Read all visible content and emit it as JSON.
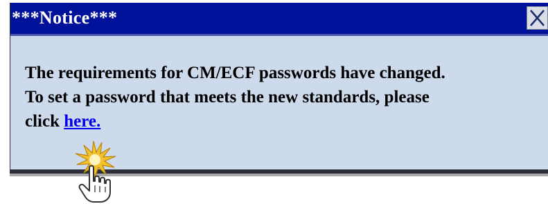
{
  "notice": {
    "title": "***Notice***",
    "line1": "The requirements for CM/ECF passwords have changed.",
    "line2": "To set a password that meets the new standards, please",
    "line3_prefix": "click ",
    "link_text": "here."
  },
  "icons": {
    "close": "close-icon",
    "click_burst": "click-burst-icon",
    "cursor": "hand-pointer-icon"
  },
  "colors": {
    "title_bar": "#00129a",
    "panel_background": "#cddaec",
    "link": "#0000ee",
    "burst": "#f2c12e"
  }
}
